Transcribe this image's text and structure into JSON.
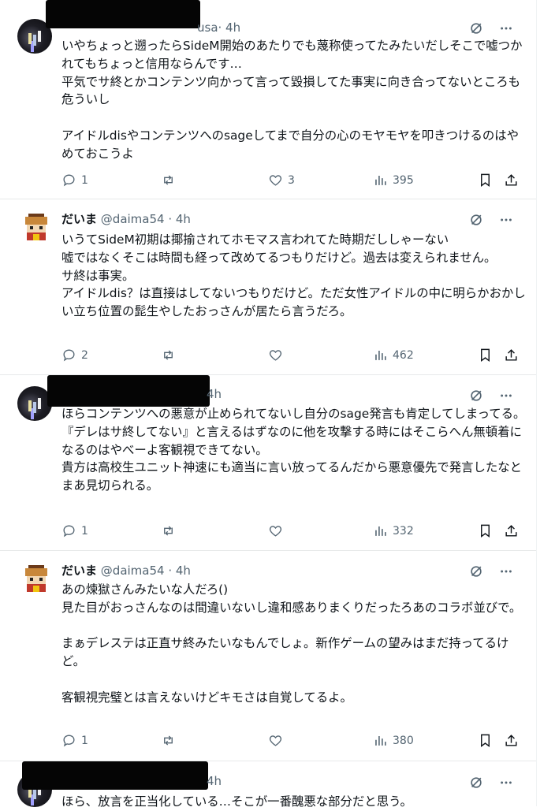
{
  "tweets": [
    {
      "handle_suffix": "usa",
      "time": "· 4h",
      "text": "いやちょっと遡ったらSideM開始のあたりでも蔑称使ってたみたいだしそこで嘘つかれてもちょっと信用ならんです…\n平気でサ終とかコンテンツ向かって言って毀損してた事実に向き合ってないところも危ういし\n\nアイドルdisやコンテンツへのsageしてまで自分の心のモヤモヤを叩きつけるのはやめておこうよ",
      "replies": "1",
      "reposts": "",
      "likes": "3",
      "views": "395"
    },
    {
      "name": "だいま",
      "handle": "@daima54 · 4h",
      "text": "いうてSideM初期は揶揄されてホモマス言われてた時期だししゃーない\n嘘ではなくそこは時間も経って改めてるつもりだけど。過去は変えられません。\nサ終は事実。\nアイドルdis？は直接はしてないつもりだけど。ただ女性アイドルの中に明らかおかしい立ち位置の髭生やしたおっさんが居たら言うだろ。",
      "replies": "2",
      "reposts": "",
      "likes": "",
      "views": "462"
    },
    {
      "time": "4h",
      "text": "ほらコンテンツへの悪意が止められてないし自分のsage発言も肯定してしまってる。\n『デレはサ終してない』と言えるはずなのに他を攻撃する時にはそこらへん無頓着になるのはやべーよ客観視できてない。\n貴方は高校生ユニット神速にも適当に言い放ってるんだから悪意優先で発言したなとまあ見切られる。",
      "replies": "1",
      "reposts": "",
      "likes": "",
      "views": "332"
    },
    {
      "name": "だいま",
      "handle": "@daima54 · 4h",
      "text": "あの煉獄さんみたいな人だろ()\n見た目がおっさんなのは間違いないし違和感ありまくりだったろあのコラボ並びで。\n\nまぁデレステは正直サ終みたいなもんでしょ。新作ゲームの望みはまだ持ってるけど。\n\n客観視完璧とは言えないけどキモさは自覚してるよ。",
      "replies": "1",
      "reposts": "",
      "likes": "",
      "views": "380"
    },
    {
      "time": "4h",
      "text": "ほら、放言を正当化している…そこが一番醜悪な部分だと思う。"
    }
  ],
  "icons": [
    "grok-icon",
    "more-icon",
    "reply-icon",
    "repost-icon",
    "like-icon",
    "views-icon",
    "bookmark-icon",
    "share-icon"
  ],
  "colors": {
    "text": "#0f1419",
    "secondary": "#536471",
    "divider": "#e7e9ea"
  }
}
